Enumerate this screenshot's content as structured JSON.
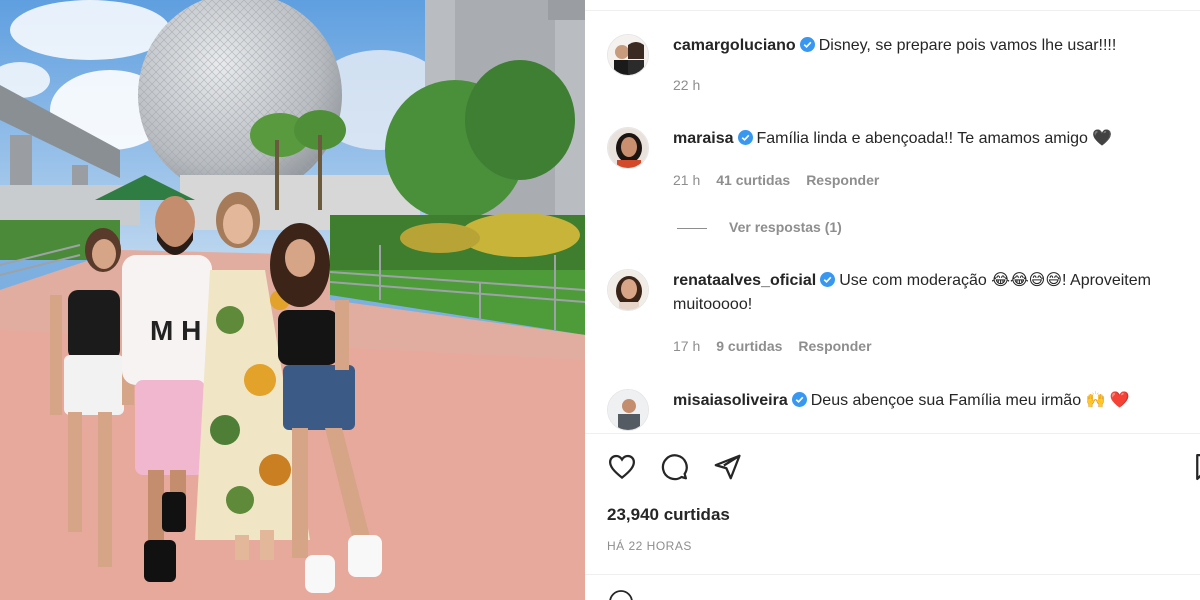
{
  "post": {
    "author": "camargoluciano",
    "caption": "Disney, se prepare pois vamos lhe usar!!!!",
    "time": "22 h"
  },
  "comments": [
    {
      "user": "maraisa",
      "text": "Família linda e abençoada!! Te amamos amigo 🖤",
      "time": "21 h",
      "likes": "41 curtidas",
      "reply": "Responder",
      "view_replies": "Ver respostas (1)"
    },
    {
      "user": "renataalves_oficial",
      "text": "Use com moderação 😂😂😅😅! Aproveitem muitooooo!",
      "time": "17 h",
      "likes": "9 curtidas",
      "reply": "Responder"
    },
    {
      "user": "misaiasoliveira",
      "text": "Deus abençoe sua Família meu irmão 🙌 ❤️"
    }
  ],
  "actions": {
    "like_icon": "heart-icon",
    "comment_icon": "comment-icon",
    "share_icon": "send-icon",
    "save_icon": "bookmark-icon"
  },
  "stats": {
    "likes": "23,940 curtidas",
    "posted": "HÁ 22 HORAS"
  },
  "colors": {
    "verified": "#3897f0",
    "muted": "#8e8e8e",
    "text": "#262626"
  }
}
